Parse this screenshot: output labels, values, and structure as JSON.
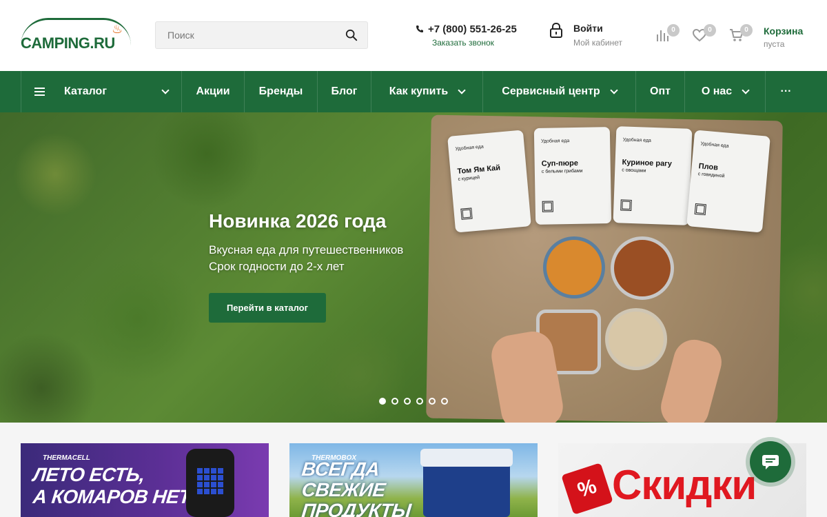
{
  "header": {
    "logo": {
      "text": "CAMPING",
      "suffix": ".RU"
    },
    "search": {
      "placeholder": "Поиск"
    },
    "phone": {
      "number": "+7 (800) 551-26-25",
      "callback": "Заказать звонок"
    },
    "account": {
      "title": "Войти",
      "subtitle": "Мой кабинет"
    },
    "compare": {
      "count": "0"
    },
    "favorites": {
      "count": "0"
    },
    "cart": {
      "count": "0",
      "title": "Корзина",
      "subtitle": "пуста"
    }
  },
  "nav": {
    "catalog": "Каталог",
    "items": [
      "Акции",
      "Бренды",
      "Блог",
      "Как купить",
      "Сервисный центр",
      "Опт",
      "О нас"
    ],
    "more": "···"
  },
  "hero": {
    "title": "Новинка 2026 года",
    "line1": "Вкусная еда для путешественников",
    "line2": "Срок годности до 2-х лет",
    "button": "Перейти в каталог",
    "pouches": [
      {
        "brand": "Удобная еда",
        "name": "Том Ям Кай",
        "sub": "с курицей"
      },
      {
        "brand": "Удобная еда",
        "name": "Суп-пюре",
        "sub": "с белыми грибами"
      },
      {
        "brand": "Удобная еда",
        "name": "Куриное рагу",
        "sub": "с овощами"
      },
      {
        "brand": "Удобная еда",
        "name": "Плов",
        "sub": "с говядиной"
      }
    ],
    "slides_total": 6,
    "active_slide": 1
  },
  "promos": [
    {
      "brand": "THERMACELL",
      "line1": "ЛЕТО ЕСТЬ,",
      "line2": "А КОМАРОВ НЕТ"
    },
    {
      "brand": "THERMOBOX",
      "line1": "ВСЕГДА",
      "line2": "СВЕЖИЕ",
      "line3": "ПРОДУКТЫ"
    },
    {
      "tag": "%",
      "text": "Скидки"
    }
  ],
  "colors": {
    "brand_green": "#1e6b3a",
    "discount_red": "#e01820",
    "accent_orange": "#e36b1b"
  }
}
